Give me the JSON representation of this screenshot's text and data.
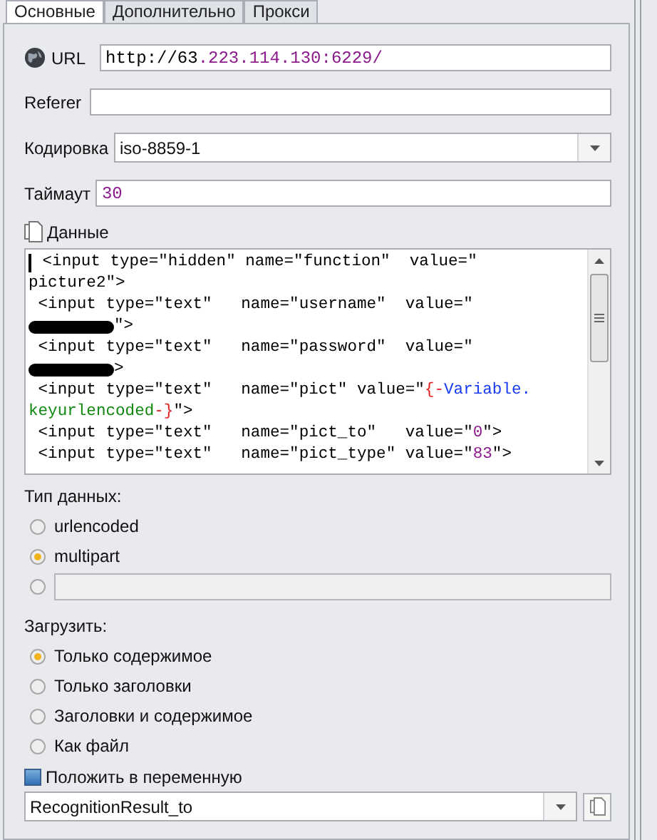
{
  "tabs": [
    {
      "label": "Основные",
      "selected": true
    },
    {
      "label": "Дополнительно",
      "selected": false
    },
    {
      "label": "Прокси",
      "selected": false
    }
  ],
  "url": {
    "label": "URL",
    "value": [
      {
        "kind": "plain",
        "t": "http://63"
      },
      {
        "kind": "number",
        "t": ".223.114.130:6229/"
      }
    ]
  },
  "referer": {
    "label": "Referer"
  },
  "encoding": {
    "label": "Кодировка",
    "value": "iso-8859-1"
  },
  "timeout": {
    "label": "Таймаут",
    "value": "30"
  },
  "data": {
    "label": "Данные",
    "lines": [
      [
        {
          "kind": "plain",
          "t": " <input type=\"hidden\" name=\"function\"  value=\""
        }
      ],
      [
        {
          "kind": "plain",
          "t": "picture2\">"
        }
      ],
      [
        {
          "kind": "plain",
          "t": " <input type=\"text\"   name=\"username\"  value=\""
        }
      ],
      [
        {
          "kind": "redacted"
        },
        {
          "kind": "plain",
          "t": "\">"
        }
      ],
      [
        {
          "kind": "plain",
          "t": " <input type=\"text\"   name=\"password\"  value=\""
        }
      ],
      [
        {
          "kind": "redacted"
        },
        {
          "kind": "plain",
          "t": ">"
        }
      ],
      [
        {
          "kind": "plain",
          "t": " <input type=\"text\"   name=\"pict\" value=\""
        },
        {
          "kind": "brace",
          "t": "{-"
        },
        {
          "kind": "variable",
          "t": "Variable."
        }
      ],
      [
        {
          "kind": "key",
          "t": "keyurlencoded"
        },
        {
          "kind": "brace",
          "t": "-}"
        },
        {
          "kind": "plain",
          "t": "\">"
        }
      ],
      [
        {
          "kind": "plain",
          "t": " <input type=\"text\"   name=\"pict_to\"   value=\""
        },
        {
          "kind": "number",
          "t": "0"
        },
        {
          "kind": "plain",
          "t": "\">"
        }
      ],
      [
        {
          "kind": "plain",
          "t": " <input type=\"text\"   name=\"pict_type\" value=\""
        },
        {
          "kind": "number",
          "t": "83"
        },
        {
          "kind": "plain",
          "t": "\">"
        }
      ]
    ]
  },
  "data_type": {
    "label": "Тип данных:",
    "options": [
      {
        "kind": "label",
        "label": "urlencoded",
        "selected": false
      },
      {
        "kind": "label",
        "label": "multipart",
        "selected": true
      },
      {
        "kind": "field",
        "selected": false
      }
    ]
  },
  "load": {
    "label": "Загрузить:",
    "options": [
      {
        "label": "Только содержимое",
        "selected": true
      },
      {
        "label": "Только заголовки",
        "selected": false
      },
      {
        "label": "Заголовки и содержимое",
        "selected": false
      },
      {
        "label": "Как файл",
        "selected": false
      }
    ]
  },
  "save_to_variable": {
    "label": "Положить в переменную",
    "value": "RecognitionResult_to"
  }
}
